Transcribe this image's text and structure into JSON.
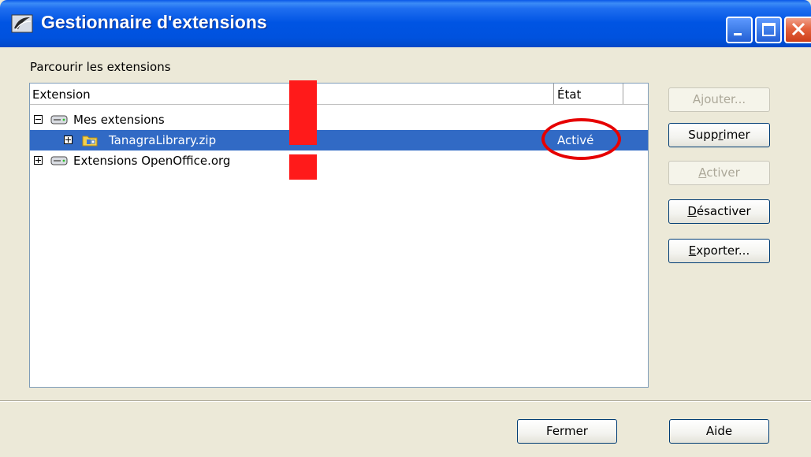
{
  "window": {
    "title": "Gestionnaire d'extensions"
  },
  "browse": {
    "label": "Parcourir les extensions"
  },
  "tree": {
    "columns": {
      "extension": "Extension",
      "state": "État"
    },
    "rows": [
      {
        "label": "Mes extensions",
        "expander": "minus",
        "icon": "drive-icon",
        "state": ""
      },
      {
        "label": "TanagraLibrary.zip",
        "expander": "plus",
        "icon": "package-folder-icon",
        "state": "Activé",
        "selected": true
      },
      {
        "label": "Extensions OpenOffice.org",
        "expander": "plus",
        "icon": "drive-icon",
        "state": ""
      }
    ]
  },
  "buttons": {
    "add": {
      "label": "Ajouter...",
      "enabled": false
    },
    "remove": {
      "pre": "Supp",
      "key": "r",
      "post": "imer",
      "enabled": true
    },
    "enable": {
      "pre": "",
      "key": "A",
      "post": "ctiver",
      "enabled": false
    },
    "disable": {
      "pre": "",
      "key": "D",
      "post": "ésactiver",
      "enabled": true
    },
    "export": {
      "pre": "",
      "key": "E",
      "post": "xporter...",
      "enabled": true
    },
    "close": {
      "label": "Fermer"
    },
    "help": {
      "label": "Aide"
    }
  },
  "colors": {
    "titlebar": "#0054e3",
    "selection": "#316ac5",
    "annotation": "#ff1a1a"
  }
}
